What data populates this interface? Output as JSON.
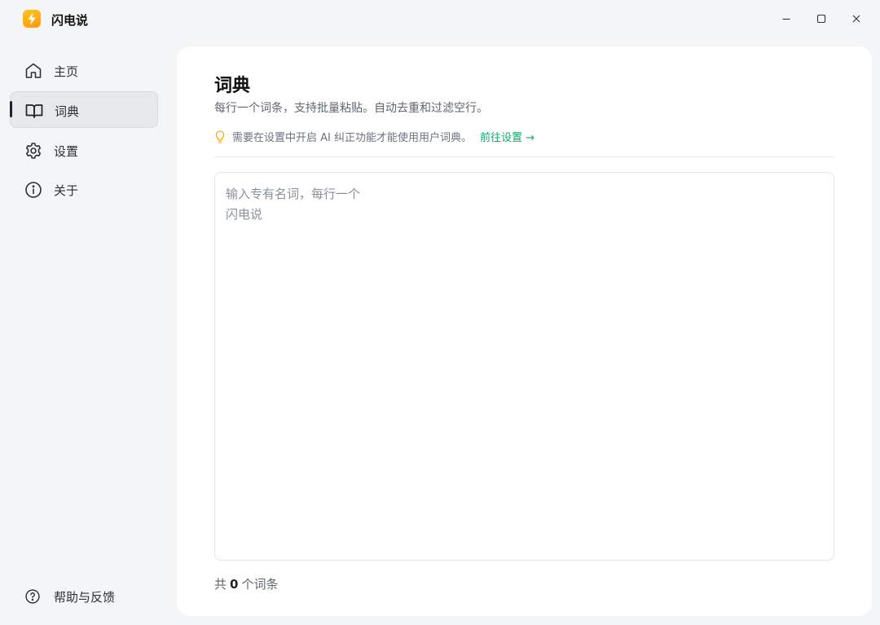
{
  "app": {
    "title": "闪电说"
  },
  "sidebar": {
    "items": [
      {
        "label": "主页",
        "icon": "home-icon"
      },
      {
        "label": "词典",
        "icon": "book-icon",
        "active": true
      },
      {
        "label": "设置",
        "icon": "gear-icon"
      },
      {
        "label": "关于",
        "icon": "info-icon"
      }
    ],
    "help_label": "帮助与反馈"
  },
  "dictionary": {
    "title": "词典",
    "subtitle": "每行一个词条，支持批量粘贴。自动去重和过滤空行。",
    "hint_text": "需要在设置中开启 AI 纠正功能才能使用用户词典。",
    "hint_link": "前往设置 →",
    "editor_placeholder": "输入专有名词，每行一个\n闪电说",
    "count_prefix": "共",
    "count_value": "0",
    "count_suffix": "个词条"
  },
  "colors": {
    "accent": "#19a56b",
    "logo": "#ffb414",
    "hint_bulb": "#f2b01e"
  }
}
